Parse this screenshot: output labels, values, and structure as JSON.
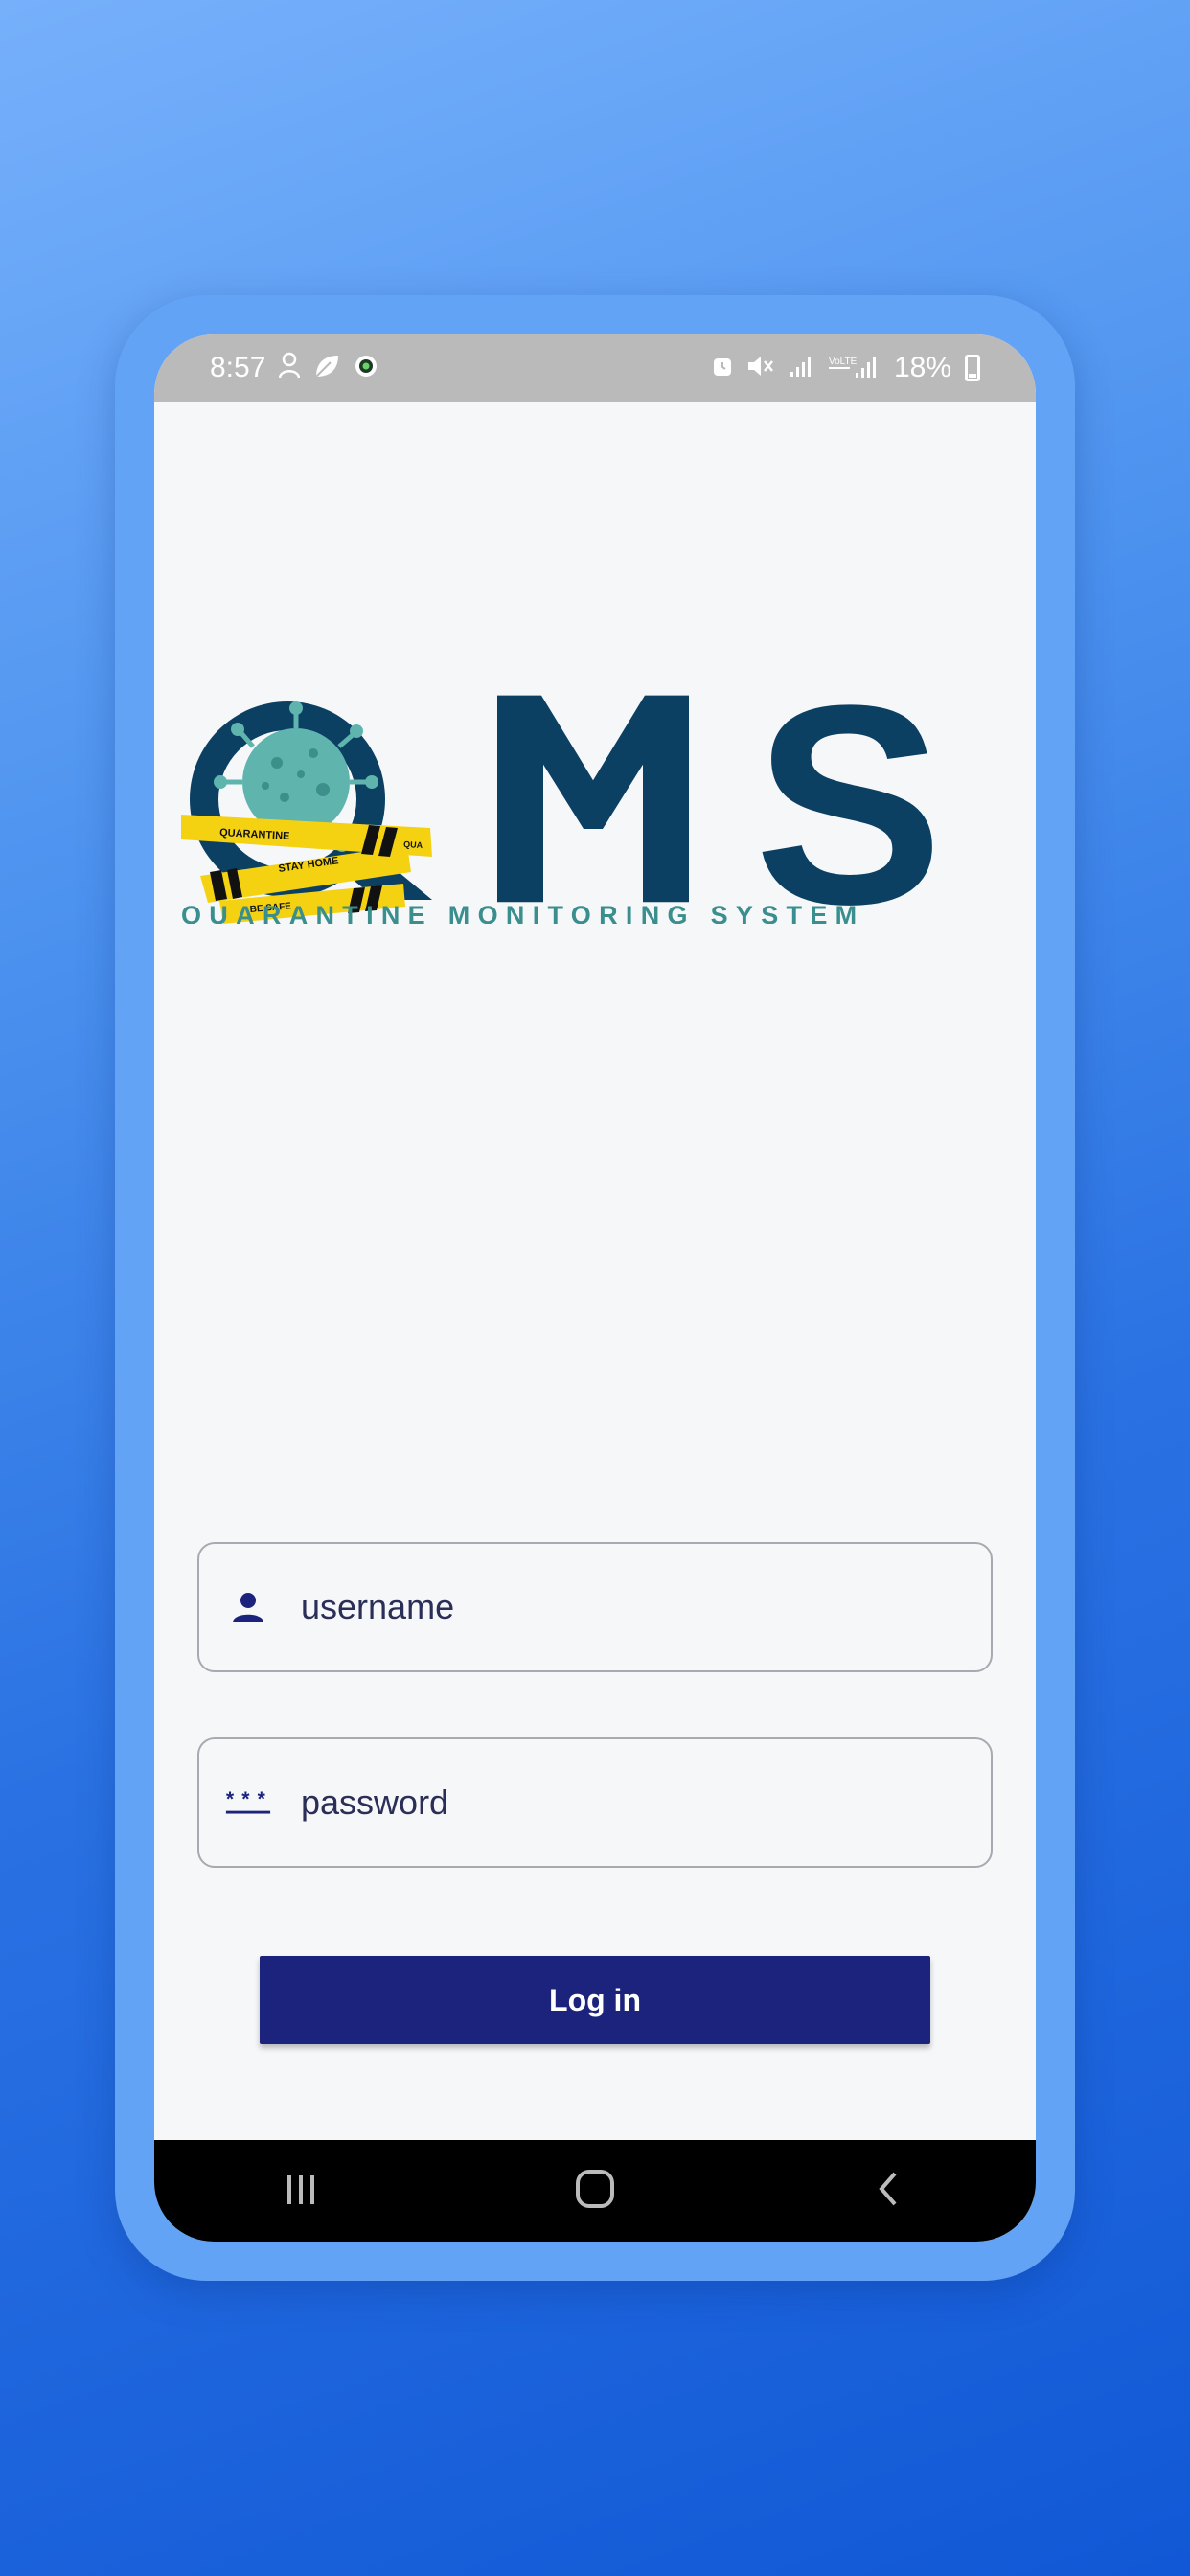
{
  "status_bar": {
    "time": "8:57",
    "left_icons": [
      "account-icon",
      "leaf-icon",
      "record-icon"
    ],
    "right_icons": [
      "alarm-icon",
      "mute-icon",
      "signal-icon",
      "volte-signal-icon"
    ],
    "battery": "18%"
  },
  "logo": {
    "letters": [
      "Q",
      "M",
      "S"
    ],
    "tape_texts": [
      "QUARANTINE",
      "STAY HOME",
      "BE SAFE",
      "QUA"
    ],
    "tagline": "QUARANTINE MONITORING SYSTEM",
    "colors": {
      "navy": "#0b4063",
      "teal": "#3a8f8e",
      "virus": "#5fb4ae",
      "tape": "#f4d212"
    }
  },
  "form": {
    "username_placeholder": "username",
    "password_placeholder": "password",
    "login_label": "Log in"
  },
  "nav": {
    "recents": "recents-icon",
    "home": "home-icon",
    "back": "back-icon"
  },
  "colors": {
    "accent": "#1c237c",
    "background_top": "#76b0fb",
    "background_bottom": "#1158d6",
    "frame": "#63a3f5"
  }
}
